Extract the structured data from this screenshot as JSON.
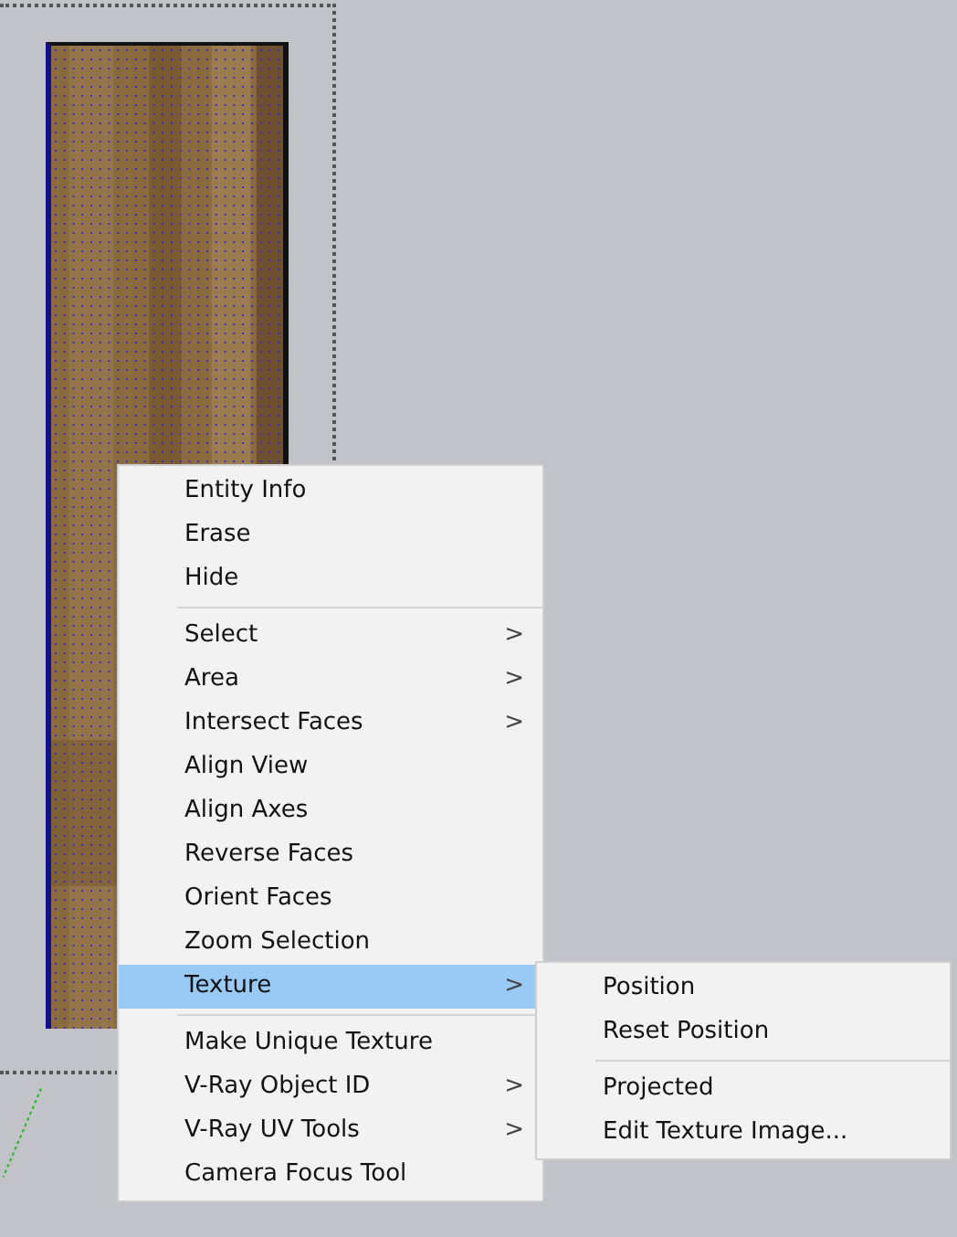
{
  "context_menu": {
    "items": [
      {
        "kind": "item",
        "label": "Entity Info",
        "selected": false
      },
      {
        "kind": "item",
        "label": "Erase",
        "selected": false
      },
      {
        "kind": "item",
        "label": "Hide",
        "selected": false
      },
      {
        "kind": "separator"
      },
      {
        "kind": "item",
        "label": "Select",
        "arrow": ">",
        "selected": false
      },
      {
        "kind": "item",
        "label": "Area",
        "arrow": ">",
        "selected": false
      },
      {
        "kind": "item",
        "label": "Intersect Faces",
        "arrow": ">",
        "selected": false
      },
      {
        "kind": "item",
        "label": "Align View",
        "selected": false
      },
      {
        "kind": "item",
        "label": "Align Axes",
        "selected": false
      },
      {
        "kind": "item",
        "label": "Reverse Faces",
        "selected": false
      },
      {
        "kind": "item",
        "label": "Orient Faces",
        "selected": false
      },
      {
        "kind": "item",
        "label": "Zoom Selection",
        "selected": false
      },
      {
        "kind": "item",
        "label": "Texture",
        "arrow": ">",
        "selected": true
      },
      {
        "kind": "separator"
      },
      {
        "kind": "item",
        "label": "Make Unique Texture",
        "selected": false
      },
      {
        "kind": "item",
        "label": "V-Ray Object ID",
        "arrow": ">",
        "selected": false
      },
      {
        "kind": "item",
        "label": "V-Ray UV Tools",
        "arrow": ">",
        "selected": false
      },
      {
        "kind": "item",
        "label": "Camera Focus Tool",
        "selected": false
      }
    ]
  },
  "submenu": {
    "items": [
      {
        "kind": "item",
        "label": "Position",
        "selected": false
      },
      {
        "kind": "item",
        "label": "Reset Position",
        "selected": false
      },
      {
        "kind": "separator"
      },
      {
        "kind": "item",
        "label": "Projected",
        "selected": false
      },
      {
        "kind": "item",
        "label": "Edit Texture Image...",
        "selected": false
      }
    ]
  }
}
